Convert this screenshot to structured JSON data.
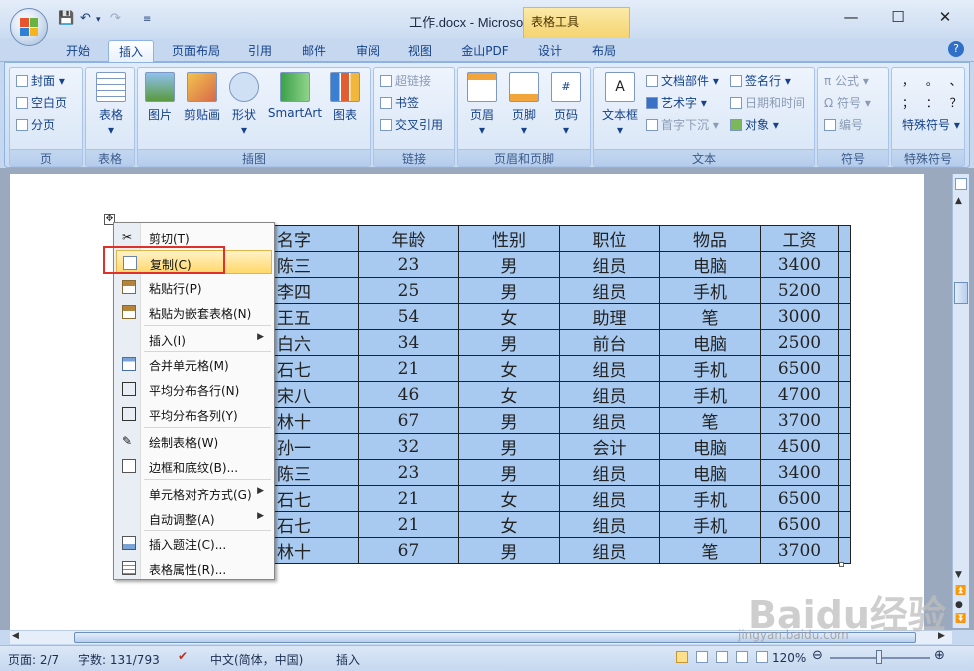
{
  "window": {
    "title": "工作.docx - Microsoft Word",
    "context_tab": "表格工具"
  },
  "tabs": [
    {
      "label": "开始",
      "active": false
    },
    {
      "label": "插入",
      "active": true
    },
    {
      "label": "页面布局",
      "active": false
    },
    {
      "label": "引用",
      "active": false
    },
    {
      "label": "邮件",
      "active": false
    },
    {
      "label": "审阅",
      "active": false
    },
    {
      "label": "视图",
      "active": false
    },
    {
      "label": "金山PDF",
      "active": false
    },
    {
      "label": "设计",
      "active": false
    },
    {
      "label": "布局",
      "active": false
    }
  ],
  "ribbon": {
    "pages": {
      "cover": "封面",
      "blank": "空白页",
      "break": "分页",
      "label": "页"
    },
    "tables": {
      "table": "表格",
      "label": "表格"
    },
    "illustrations": {
      "picture": "图片",
      "clipart": "剪贴画",
      "shapes": "形状",
      "smartart": "SmartArt",
      "chart": "图表",
      "label": "插图"
    },
    "links": {
      "hyperlink": "超链接",
      "bookmark": "书签",
      "crossref": "交叉引用",
      "label": "链接"
    },
    "headerfooter": {
      "header": "页眉",
      "footer": "页脚",
      "pagenum": "页码",
      "label": "页眉和页脚"
    },
    "text": {
      "textbox": "文本框",
      "quickparts": "文档部件",
      "wordart": "艺术字",
      "dropcap": "首字下沉",
      "signature": "签名行",
      "datetime": "日期和时间",
      "object": "对象",
      "label": "文本"
    },
    "symbols": {
      "equation": "公式",
      "symbol": "符号",
      "number": "编号",
      "label": "符号"
    },
    "special": {
      "row1": "， 。 、",
      "row2": "； ： ？",
      "row3": "特殊符号",
      "label": "特殊符号"
    }
  },
  "table": {
    "headers": [
      "名字",
      "年龄",
      "性别",
      "职位",
      "物品",
      "工资"
    ],
    "rows": [
      [
        "陈三",
        "23",
        "男",
        "组员",
        "电脑",
        "3400"
      ],
      [
        "李四",
        "25",
        "男",
        "组员",
        "手机",
        "5200"
      ],
      [
        "王五",
        "54",
        "女",
        "助理",
        "笔",
        "3000"
      ],
      [
        "白六",
        "34",
        "男",
        "前台",
        "电脑",
        "2500"
      ],
      [
        "石七",
        "21",
        "女",
        "组员",
        "手机",
        "6500"
      ],
      [
        "宋八",
        "46",
        "女",
        "组员",
        "手机",
        "4700"
      ],
      [
        "林十",
        "67",
        "男",
        "组员",
        "笔",
        "3700"
      ],
      [
        "孙一",
        "32",
        "男",
        "会计",
        "电脑",
        "4500"
      ],
      [
        "陈三",
        "23",
        "男",
        "组员",
        "电脑",
        "3400"
      ],
      [
        "石七",
        "21",
        "女",
        "组员",
        "手机",
        "6500"
      ],
      [
        "石七",
        "21",
        "女",
        "组员",
        "手机",
        "6500"
      ],
      [
        "林十",
        "67",
        "男",
        "组员",
        "笔",
        "3700"
      ]
    ]
  },
  "context_menu": {
    "items": [
      {
        "label": "剪切(T)",
        "icon": "scissors-icon"
      },
      {
        "label": "复制(C)",
        "icon": "copy-icon",
        "highlighted": true
      },
      {
        "label": "粘贴行(P)",
        "icon": "paste-icon"
      },
      {
        "label": "粘贴为嵌套表格(N)",
        "icon": "paste-icon"
      },
      {
        "label": "插入(I)",
        "submenu": true
      },
      {
        "label": "合并单元格(M)",
        "icon": "merge-cells-icon"
      },
      {
        "label": "平均分布各行(N)",
        "icon": "distribute-rows-icon"
      },
      {
        "label": "平均分布各列(Y)",
        "icon": "distribute-columns-icon"
      },
      {
        "label": "绘制表格(W)",
        "icon": "pencil-icon"
      },
      {
        "label": "边框和底纹(B)...",
        "icon": "borders-icon"
      },
      {
        "label": "单元格对齐方式(G)",
        "submenu": true
      },
      {
        "label": "自动调整(A)",
        "submenu": true
      },
      {
        "label": "插入题注(C)...",
        "icon": "caption-icon"
      },
      {
        "label": "表格属性(R)...",
        "icon": "table-properties-icon"
      }
    ]
  },
  "status": {
    "page": "页面: 2/7",
    "words": "字数: 131/793",
    "language": "中文(简体，中国)",
    "mode": "插入",
    "zoom": "120%"
  },
  "watermark": {
    "brand": "Baidu经验",
    "url": "jingyan.baidu.com"
  }
}
